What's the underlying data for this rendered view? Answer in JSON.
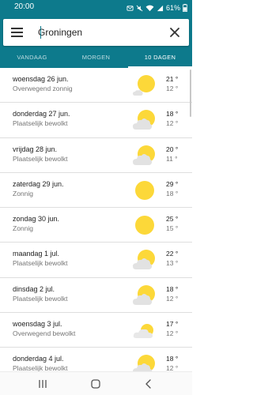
{
  "status_bar": {
    "time": "20:00",
    "battery": "61%",
    "icons": [
      "notification-icon",
      "mute-icon",
      "wifi-icon",
      "signal-icon",
      "battery-icon"
    ]
  },
  "search": {
    "value": "Groningen",
    "menu_icon": "hamburger-menu-icon",
    "clear_icon": "close-icon"
  },
  "tabs": [
    {
      "label": "VANDAAG",
      "active": false
    },
    {
      "label": "MORGEN",
      "active": false
    },
    {
      "label": "10 DAGEN",
      "active": true
    }
  ],
  "forecast": [
    {
      "day": "woensdag 26 jun.",
      "desc": "Overwegend zonnig",
      "icon": "mostly-sunny-icon",
      "high": "21 °",
      "low": "12 °"
    },
    {
      "day": "donderdag 27 jun.",
      "desc": "Plaatselijk bewolkt",
      "icon": "partly-cloudy-icon",
      "high": "18 °",
      "low": "12 °"
    },
    {
      "day": "vrijdag 28 jun.",
      "desc": "Plaatselijk bewolkt",
      "icon": "partly-cloudy-icon",
      "high": "20 °",
      "low": "11 °"
    },
    {
      "day": "zaterdag 29 jun.",
      "desc": "Zonnig",
      "icon": "sunny-icon",
      "high": "29 °",
      "low": "18 °"
    },
    {
      "day": "zondag 30 jun.",
      "desc": "Zonnig",
      "icon": "sunny-icon",
      "high": "25 °",
      "low": "15 °"
    },
    {
      "day": "maandag 1 jul.",
      "desc": "Plaatselijk bewolkt",
      "icon": "partly-cloudy-icon",
      "high": "22 °",
      "low": "13 °"
    },
    {
      "day": "dinsdag 2 jul.",
      "desc": "Plaatselijk bewolkt",
      "icon": "partly-cloudy-icon",
      "high": "18 °",
      "low": "12 °"
    },
    {
      "day": "woensdag 3 jul.",
      "desc": "Overwegend bewolkt",
      "icon": "mostly-cloudy-icon",
      "high": "17 °",
      "low": "12 °"
    },
    {
      "day": "donderdag 4 jul.",
      "desc": "Plaatselijk bewolkt",
      "icon": "partly-cloudy-icon",
      "high": "18 °",
      "low": "12 °"
    }
  ],
  "nav": {
    "recents_icon": "recent-apps-icon",
    "home_icon": "home-icon",
    "back_icon": "back-icon"
  },
  "colors": {
    "primary": "#0d7a8c",
    "sun": "#fcd839",
    "cloud": "#e2e2e2"
  }
}
